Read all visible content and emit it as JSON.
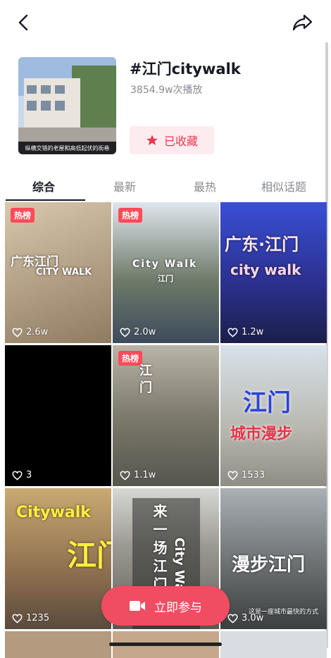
{
  "topic": {
    "title": "#江门citywalk",
    "plays": "3854.9w次播放",
    "cover_caption": "纵横交错的老屋和高低起伏的街巷",
    "collect_label": "已收藏"
  },
  "tabs": [
    {
      "label": "综合",
      "active": true
    },
    {
      "label": "最新",
      "active": false
    },
    {
      "label": "最热",
      "active": false
    },
    {
      "label": "相似话题",
      "active": false
    }
  ],
  "hot_badge_label": "热榜",
  "videos": [
    {
      "likes": "2.6w",
      "hot": true,
      "title_lines": [
        "广东江门",
        "CITY WALK"
      ]
    },
    {
      "likes": "2.0w",
      "hot": true,
      "title_lines": [
        "City Walk",
        "江门"
      ]
    },
    {
      "likes": "1.2w",
      "hot": false,
      "title_lines": [
        "广东·江门",
        "city walk"
      ]
    },
    {
      "likes": "3",
      "hot": false,
      "title_lines": []
    },
    {
      "likes": "1.1w",
      "hot": true,
      "title_lines": [
        "江",
        "门"
      ]
    },
    {
      "likes": "1533",
      "hot": false,
      "title_lines": [
        "江门",
        "城市漫步"
      ]
    },
    {
      "likes": "1235",
      "hot": false,
      "title_lines": [
        "Citywalk",
        "江门"
      ]
    },
    {
      "likes": "",
      "hot": false,
      "title_lines": [
        "来一场江门",
        "City Walk"
      ]
    },
    {
      "likes": "3.0w",
      "hot": false,
      "title_lines": [
        "漫步江门",
        "这是一座城市最快的方式"
      ]
    }
  ],
  "join_button_label": "立即参与",
  "colors": {
    "accent": "#f04d62",
    "collect_bg": "#fdecef",
    "collect_text": "#e8394f",
    "hot_badge": "#ff4a57"
  },
  "icons": {
    "back": "chevron-left-icon",
    "share": "share-arrow-icon",
    "collect": "star-icon",
    "likes": "heart-outline-icon",
    "join": "video-camera-icon"
  }
}
